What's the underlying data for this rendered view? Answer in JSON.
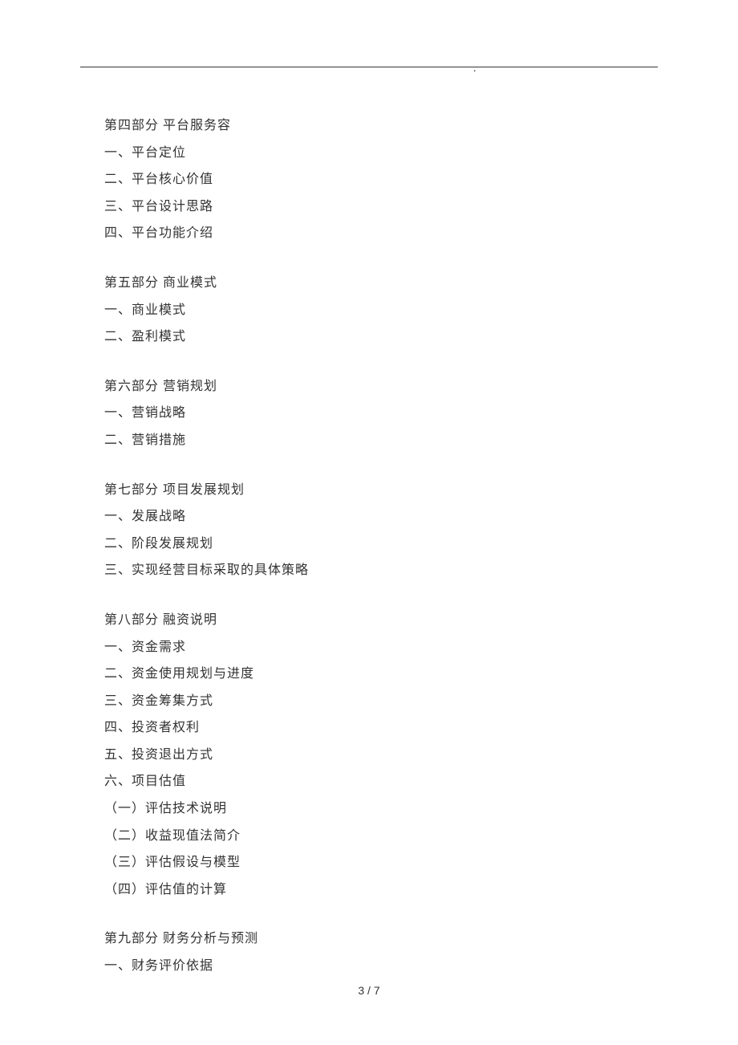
{
  "header_dot": ".",
  "sections": [
    {
      "title": "第四部分 平台服务容",
      "items": [
        "一、平台定位",
        "二、平台核心价值",
        "三、平台设计思路",
        "四、平台功能介绍"
      ]
    },
    {
      "title": "第五部分 商业模式",
      "items": [
        "一、商业模式",
        "二、盈利模式"
      ]
    },
    {
      "title": "第六部分 营销规划",
      "items": [
        "一、营销战略",
        "二、营销措施"
      ]
    },
    {
      "title": "第七部分 项目发展规划",
      "items": [
        "一、发展战略",
        "二、阶段发展规划",
        "三、实现经营目标采取的具体策略"
      ]
    },
    {
      "title": "第八部分 融资说明",
      "items": [
        "一、资金需求",
        "二、资金使用规划与进度",
        "三、资金筹集方式",
        "四、投资者权利",
        "五、投资退出方式",
        "六、项目估值",
        "（一）评估技术说明",
        "（二）收益现值法简介",
        "（三）评估假设与模型",
        "（四）评估值的计算"
      ]
    },
    {
      "title": "第九部分 财务分析与预测",
      "items": [
        "一、财务评价依据"
      ]
    }
  ],
  "page_number": "3 / 7"
}
